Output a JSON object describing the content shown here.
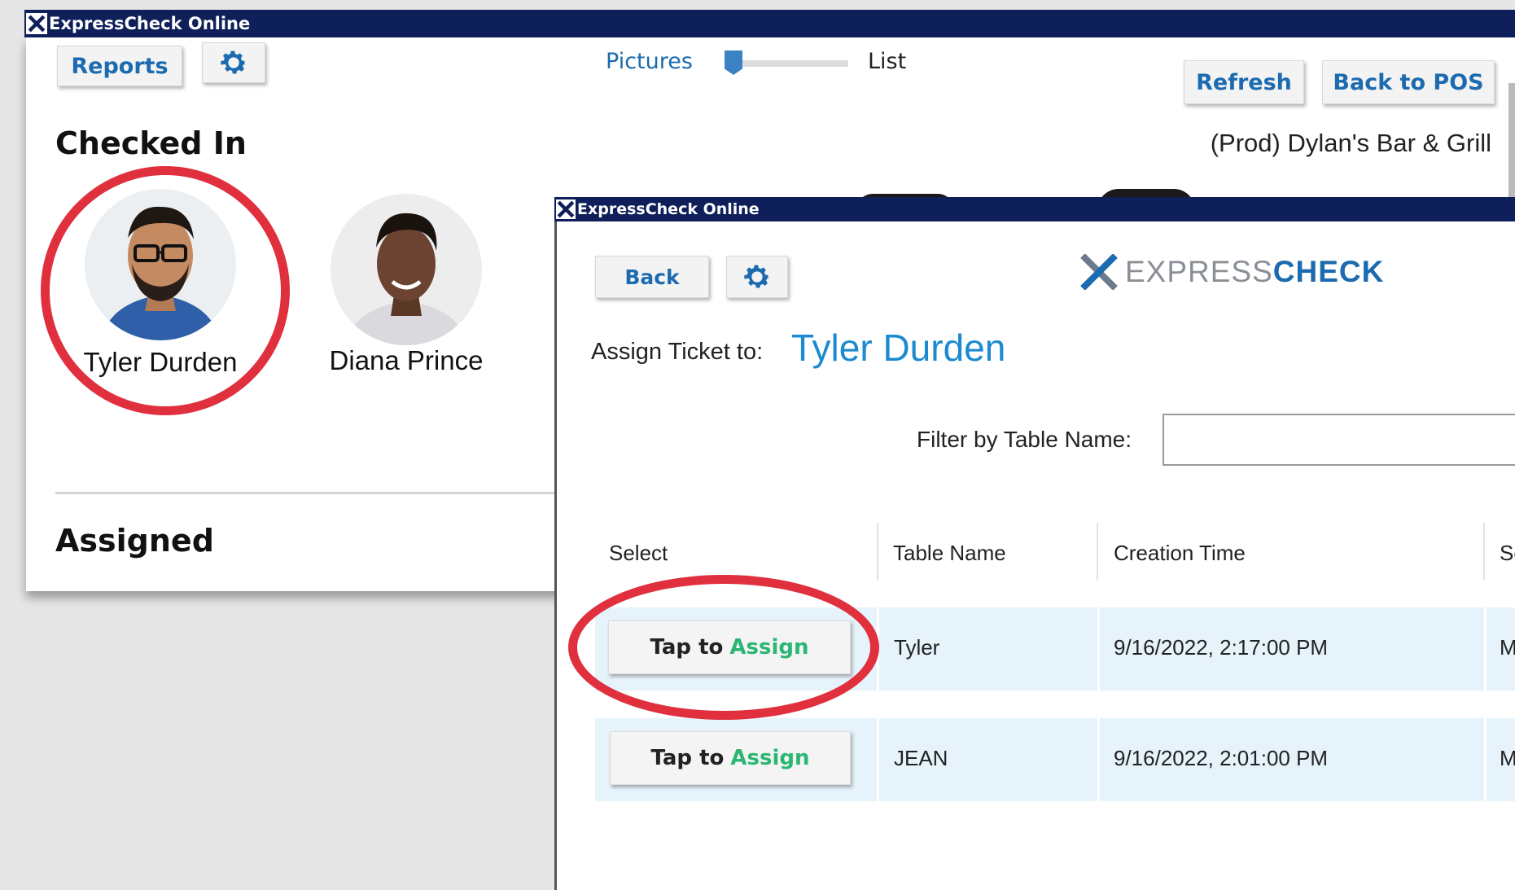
{
  "main_window": {
    "title": "ExpressCheck Online",
    "reports_label": "Reports",
    "view_toggle": {
      "left_label": "Pictures",
      "right_label": "List",
      "value": 0
    },
    "refresh_label": "Refresh",
    "back_to_pos_label": "Back to POS",
    "location": "(Prod) Dylan's Bar & Grill",
    "checked_in_heading": "Checked In",
    "assigned_heading": "Assigned",
    "people": [
      {
        "name": "Tyler Durden"
      },
      {
        "name": "Diana Prince"
      }
    ]
  },
  "modal": {
    "title": "ExpressCheck Online",
    "back_label": "Back",
    "logo": {
      "part1": "EXPRESS",
      "part2": "CHECK"
    },
    "assign_prefix": "Assign Ticket to:",
    "assign_name": "Tyler Durden",
    "filter_label": "Filter by Table Name:",
    "filter_value": "",
    "columns": [
      "Select",
      "Table Name",
      "Creation Time",
      "Se"
    ],
    "rows": [
      {
        "button_part1": "Tap to",
        "button_part2": "Assign",
        "table": "Tyler",
        "time": "9/16/2022, 2:17:00 PM",
        "extra": "M"
      },
      {
        "button_part1": "Tap to",
        "button_part2": "Assign",
        "table": "JEAN",
        "time": "9/16/2022, 2:01:00 PM",
        "extra": "M"
      }
    ]
  },
  "colors": {
    "title_bar": "#0e1f5a",
    "accent_blue": "#1c6bb0",
    "assign_green": "#2bb673",
    "highlight_red": "#e0303e",
    "row_bg": "#e6f3fb"
  },
  "icons": [
    "x-logo-icon",
    "gear-icon"
  ]
}
